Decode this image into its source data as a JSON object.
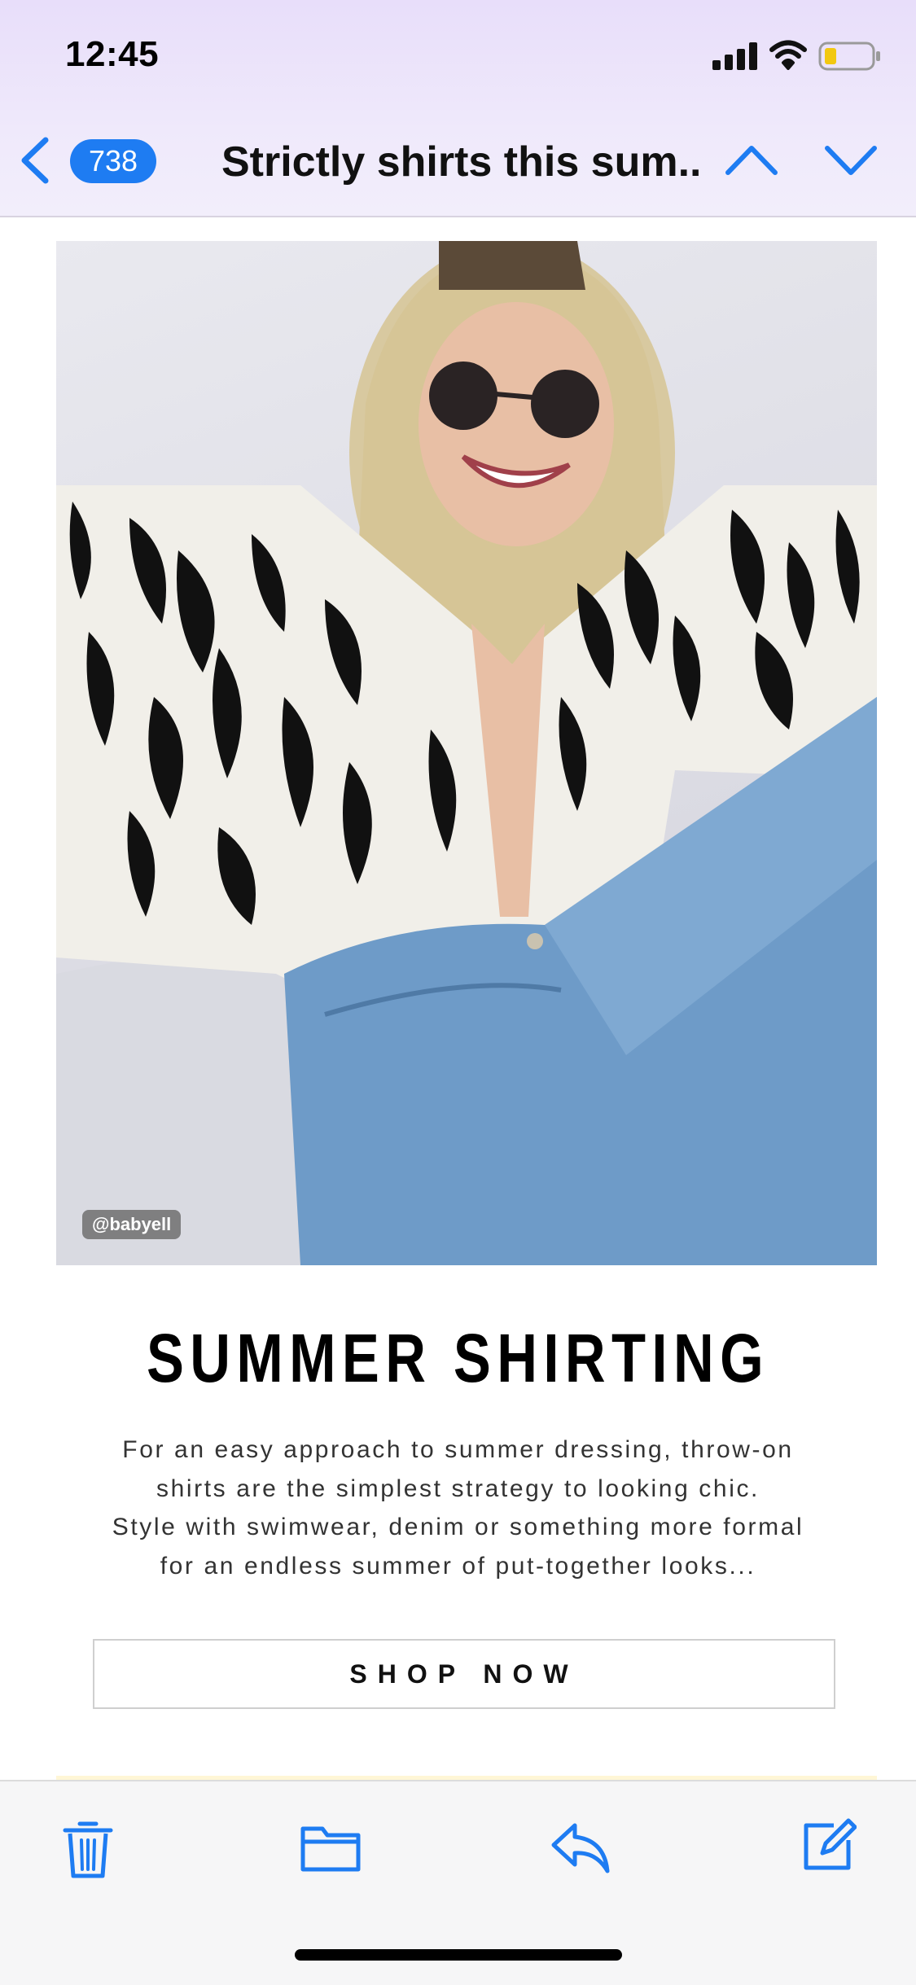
{
  "status_bar": {
    "time": "12:45",
    "icons": [
      "signal-icon",
      "wifi-icon",
      "battery-icon"
    ],
    "battery_color": "#f2c811"
  },
  "nav": {
    "back_icon": "chevron-left-icon",
    "unread_count": "738",
    "subject": "Strictly shirts this sum...",
    "prev_icon": "chevron-up-icon",
    "next_icon": "chevron-down-icon",
    "accent_color": "#1e7cf2"
  },
  "email": {
    "hero_credit": "@babyell",
    "section_title": "SUMMER SHIRTING",
    "body_lines": [
      "For an easy approach to summer dressing, throw-on",
      "shirts are the simplest strategy to looking chic.",
      "Style with swimwear, denim or something more formal",
      "for an endless summer of put-together looks..."
    ],
    "cta_label": "SHOP NOW"
  },
  "toolbar": {
    "items": [
      "trash-icon",
      "folder-icon",
      "reply-icon",
      "compose-icon"
    ]
  }
}
